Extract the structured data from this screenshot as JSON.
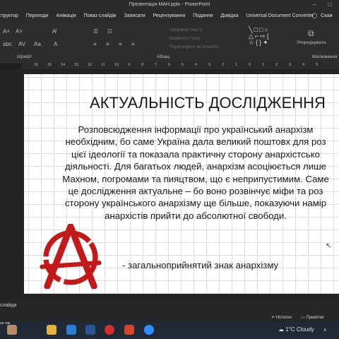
{
  "window": {
    "title": "Презентація МАН.pptx  -  PowerPoint",
    "minimize_glyph": "–",
    "maximize_glyph": "□"
  },
  "ribbon_tabs": [
    "Конструктор",
    "Переходи",
    "Анімація",
    "Показ слайдів",
    "Записати",
    "Рецензування",
    "Подання",
    "Довідка",
    "Universal Document Converter"
  ],
  "search": {
    "label": "Скаж"
  },
  "ribbon": {
    "groups": [
      "Шрифт",
      "Абзац",
      "Малювання"
    ],
    "arrange_label": "Упорядкувати",
    "faint_items": [
      "Напрямок тексту",
      "Вирівняти текст",
      "Перетворити на SmartArt"
    ]
  },
  "ruler": {
    "ticks": [
      "16",
      "15",
      "14",
      "13",
      "12",
      "11",
      "10",
      "9",
      "8",
      "7",
      "6",
      "5",
      "4",
      "3",
      "2",
      "1",
      "0",
      "1",
      "2",
      "3",
      "4",
      "5"
    ]
  },
  "slide": {
    "title": "АКТУАЛЬНІСТЬ ДОСЛІДЖЕННЯ",
    "body_lines": [
      "Розповсюдження інформації про український анархізм",
      "необхідним, бо саме Україна дала великий поштовх для роз",
      "цієї ідеології та показала практичну сторону анархістсько",
      "діяльності. Для багатьох людей, анархізм асоціюється лише",
      "Махном, погромами та пияцтвом, що є неприпустимим. Саме",
      "це дослідження актуальне – бо воно розвінчує міфи та роз",
      "сторону українського анархізму ще більше, показуючи намір",
      "анархістів прийти до абсолютної свободи."
    ],
    "caption": "- загальноприйнятий знак анархізму",
    "logo_color": "#c21a1a"
  },
  "statusbar": {
    "slide_label": "слайда",
    "notes": "Нотатки",
    "comments": "Примітки"
  },
  "taskbar": {
    "user_label": "не так",
    "weather_temp": "1°C",
    "weather_text": "Cloudy",
    "weather_icon": "cloud-icon",
    "apps": [
      "photos-app-icon",
      "file-explorer-icon",
      "clipchamp-icon",
      "word-icon",
      "opera-icon",
      "powerpoint-icon",
      "zoom-icon"
    ]
  }
}
